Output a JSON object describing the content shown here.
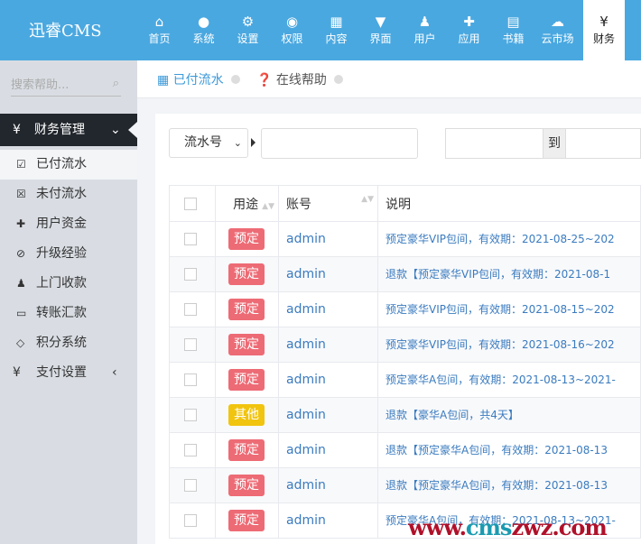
{
  "app": {
    "title": "迅睿CMS"
  },
  "nav": [
    {
      "label": "首页",
      "icon": "home-icon",
      "glyph": "⌂"
    },
    {
      "label": "系统",
      "icon": "globe-icon",
      "glyph": "●"
    },
    {
      "label": "设置",
      "icon": "gears-icon",
      "glyph": "⚙"
    },
    {
      "label": "权限",
      "icon": "user-circle-icon",
      "glyph": "◉"
    },
    {
      "label": "内容",
      "icon": "grid-icon",
      "glyph": "▦"
    },
    {
      "label": "界面",
      "icon": "html5-icon",
      "glyph": "▼"
    },
    {
      "label": "用户",
      "icon": "user-icon",
      "glyph": "♟"
    },
    {
      "label": "应用",
      "icon": "puzzle-icon",
      "glyph": "✚"
    },
    {
      "label": "书籍",
      "icon": "book-icon",
      "glyph": "▤"
    },
    {
      "label": "云市场",
      "icon": "cloud-icon",
      "glyph": "☁"
    },
    {
      "label": "财务",
      "icon": "yen-icon",
      "glyph": "¥"
    }
  ],
  "sidebar": {
    "search_placeholder": "搜索帮助...",
    "group": {
      "label": "财务管理",
      "icon": "yen-icon"
    },
    "items": [
      {
        "label": "已付流水",
        "icon": "calendar-check-icon",
        "glyph": "☑"
      },
      {
        "label": "未付流水",
        "icon": "calendar-times-icon",
        "glyph": "☒"
      },
      {
        "label": "用户资金",
        "icon": "plus-icon",
        "glyph": "✚"
      },
      {
        "label": "升级经验",
        "icon": "compass-icon",
        "glyph": "⊘"
      },
      {
        "label": "上门收款",
        "icon": "user-icon",
        "glyph": "♟"
      },
      {
        "label": "转账汇款",
        "icon": "credit-card-icon",
        "glyph": "▭"
      },
      {
        "label": "积分系统",
        "icon": "diamond-icon",
        "glyph": "◇"
      }
    ],
    "group2": {
      "label": "支付设置",
      "icon": "yen-icon"
    }
  },
  "breadcrumb": {
    "current": "已付流水",
    "help": "在线帮助"
  },
  "filter": {
    "field": "流水号",
    "to_label": "到"
  },
  "table": {
    "headers": [
      "用途",
      "账号",
      "说明"
    ],
    "colors": {
      "预定": "#ed6b75",
      "其他": "#f1c40f"
    },
    "rows": [
      {
        "type": "预定",
        "account": "admin",
        "desc": "预定豪华VIP包间，有效期：2021-08-25~202"
      },
      {
        "type": "预定",
        "account": "admin",
        "desc": "退款【预定豪华VIP包间，有效期：2021-08-1"
      },
      {
        "type": "预定",
        "account": "admin",
        "desc": "预定豪华VIP包间，有效期：2021-08-15~202"
      },
      {
        "type": "预定",
        "account": "admin",
        "desc": "预定豪华VIP包间，有效期：2021-08-16~202"
      },
      {
        "type": "预定",
        "account": "admin",
        "desc": "预定豪华A包间，有效期：2021-08-13~2021-"
      },
      {
        "type": "其他",
        "account": "admin",
        "desc": "退款【豪华A包间，共4天】"
      },
      {
        "type": "预定",
        "account": "admin",
        "desc": "退款【预定豪华A包间，有效期：2021-08-13"
      },
      {
        "type": "预定",
        "account": "admin",
        "desc": "退款【预定豪华A包间，有效期：2021-08-13"
      },
      {
        "type": "预定",
        "account": "admin",
        "desc": "预定豪华A包间，有效期：2021-08-13~2021-"
      }
    ]
  },
  "watermark": "www.cmszwz.com"
}
